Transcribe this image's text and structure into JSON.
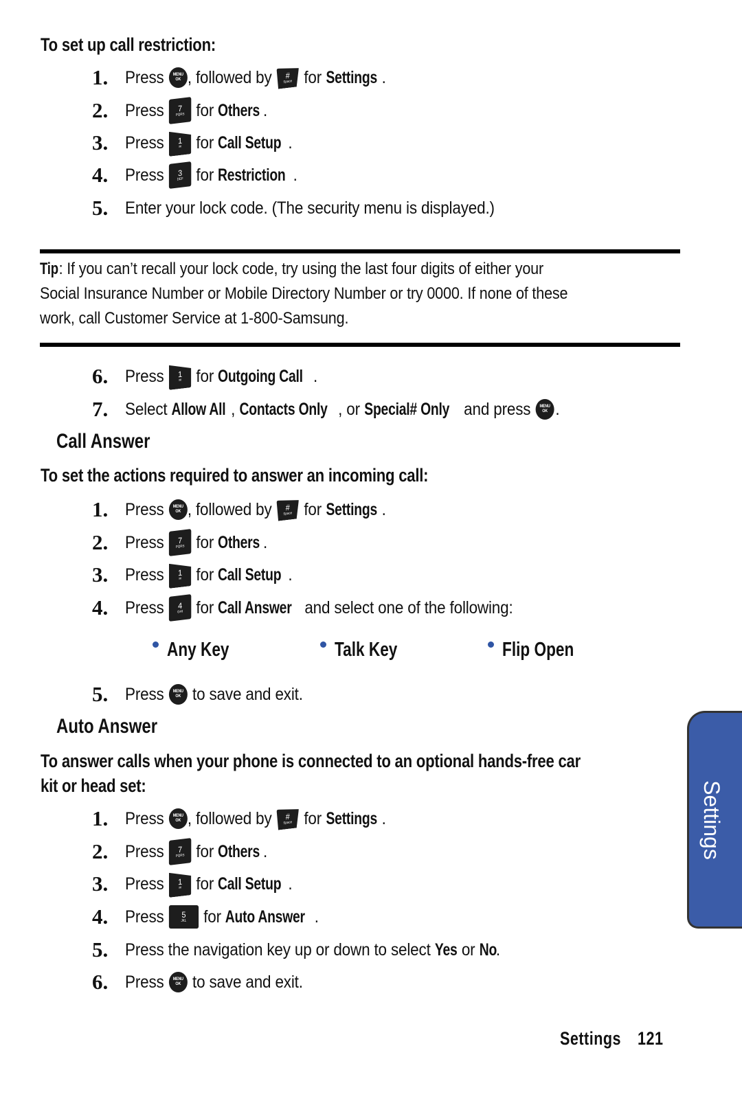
{
  "colors": {
    "accent_blue": "#3b5ca8",
    "bullet_blue": "#2f55a4",
    "text": "#111111"
  },
  "icons": {
    "menu_ok": {
      "name": "menu-ok-key-icon",
      "line1": "MENU",
      "line2": "OK"
    },
    "hash": {
      "name": "hash-space-key-icon",
      "main": "#",
      "sub": "Space"
    },
    "seven": {
      "name": "key-7-icon",
      "main": "7",
      "sub": "PQRS"
    },
    "one": {
      "name": "key-1-icon",
      "main": "1",
      "sub": "✉"
    },
    "three": {
      "name": "key-3-icon",
      "main": "3",
      "sub": "DEF"
    },
    "four": {
      "name": "key-4-icon",
      "main": "4",
      "sub": "GHI"
    },
    "five": {
      "name": "key-5-icon",
      "main": "5",
      "sub": "JKL"
    }
  },
  "section1": {
    "heading": "To set up call restriction:",
    "steps": [
      {
        "num": "1.",
        "press": "Press",
        "mid": ", followed by",
        "for": "for",
        "target": "Settings",
        "end": "."
      },
      {
        "num": "2.",
        "press": "Press",
        "for": "for",
        "target": "Others",
        "end": "."
      },
      {
        "num": "3.",
        "press": "Press",
        "for": "for",
        "target": "Call Setup",
        "end": "."
      },
      {
        "num": "4.",
        "press": "Press",
        "for": "for",
        "target": "Restriction",
        "end": "."
      },
      {
        "num": "5.",
        "text": "Enter your lock code. (The security menu is displayed.)"
      }
    ],
    "tip": {
      "label": "Tip",
      "line1": ": If you can’t recall your lock code, try using the last four digits of either your",
      "line2": "Social Insurance Number or Mobile Directory Number or try 0000. If none of these",
      "line3": "work, call Customer Service at 1-800-Samsung."
    },
    "steps_after_tip": [
      {
        "num": "6.",
        "press": "Press",
        "for": "for",
        "target": "Outgoing Call",
        "end": "."
      },
      {
        "num": "7.",
        "select": "Select",
        "opt1": "Allow All",
        "sep1": ",",
        "opt2": "Contacts Only",
        "sep2": ", or",
        "opt3": "Special# Only",
        "and_press": "and press",
        "end": "."
      }
    ]
  },
  "section2": {
    "title": "Call Answer",
    "heading": "To set the actions required to answer an incoming call:",
    "steps": [
      {
        "num": "1.",
        "press": "Press",
        "mid": ", followed by",
        "for": "for",
        "target": "Settings",
        "end": "."
      },
      {
        "num": "2.",
        "press": "Press",
        "for": "for",
        "target": "Others",
        "end": "."
      },
      {
        "num": "3.",
        "press": "Press",
        "for": "for",
        "target": "Call Setup",
        "end": "."
      },
      {
        "num": "4.",
        "press": "Press",
        "for": "for",
        "target": "Call Answer",
        "tail": "and select one of the following:"
      },
      {
        "num": "5.",
        "press": "Press",
        "tail": "to save and exit."
      }
    ],
    "options": [
      "Any Key",
      "Talk Key",
      "Flip Open"
    ]
  },
  "section3": {
    "title": "Auto Answer",
    "heading_line1": "To answer calls when your phone is connected to an optional hands-free car",
    "heading_line2": "kit or head set:",
    "steps": [
      {
        "num": "1.",
        "press": "Press",
        "mid": ", followed by",
        "for": "for",
        "target": "Settings",
        "end": "."
      },
      {
        "num": "2.",
        "press": "Press",
        "for": "for",
        "target": "Others",
        "end": "."
      },
      {
        "num": "3.",
        "press": "Press",
        "for": "for",
        "target": "Call Setup",
        "end": "."
      },
      {
        "num": "4.",
        "press": "Press",
        "for": "for",
        "target": "Auto Answer",
        "end": "."
      },
      {
        "num": "5.",
        "text_a": "Press the navigation key up or down to select",
        "yes": "Yes",
        "or": "or",
        "no": "No",
        "end": "."
      },
      {
        "num": "6.",
        "press": "Press",
        "tail": "to save and exit."
      }
    ]
  },
  "side_tab": {
    "label": "Settings"
  },
  "footer": {
    "section": "Settings",
    "page": "121"
  }
}
